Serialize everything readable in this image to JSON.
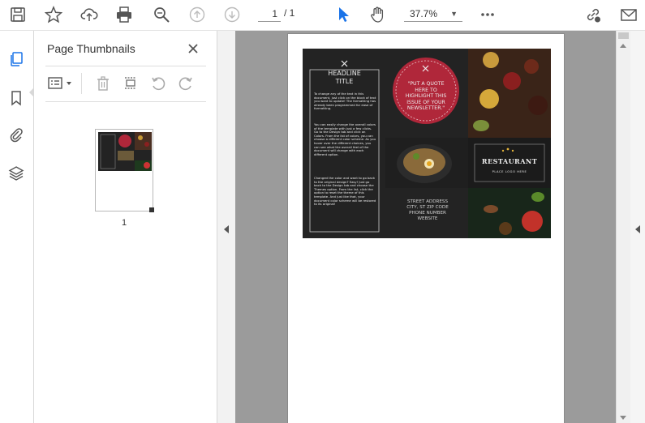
{
  "toolbar": {
    "page_current": "1",
    "page_total": "/ 1",
    "zoom": "37.7%"
  },
  "panel": {
    "title": "Page Thumbnails",
    "thumb_page_number": "1"
  },
  "brochure": {
    "headline": "HEADLINE\nTITLE",
    "body_para_1": "To change any of the text in this document, just click on the block of text you want to update! The formatting has already been programmed for ease of formatting.",
    "body_para_2": "You can easily change the overall colors of the template with just a few clicks. Go to the Design tab and click on Colors. From the list of colors, you can choose a different color scheme. As you hover over the different choices, you can see what the overall feel of the document will change with each different option.",
    "body_para_3": "Changed the color and want to go back to the original design? Easy! Just go back to the Design tab and choose the Themes option. From the list, click the option to reset the theme of this template. And just like that, your document color scheme will be restored to its original!",
    "quote": "\"PUT A QUOTE HERE TO HIGHLIGHT THIS ISSUE OF YOUR NEWSLETTER.\"",
    "restaurant_name": "RESTAURANT",
    "restaurant_tagline": "PLACE LOGO HERE",
    "address_line_1": "STREET ADDRESS",
    "address_line_2": "CITY, ST ZIP CODE",
    "address_line_3": "PHONE NUMBER",
    "address_line_4": "WEBSITE"
  },
  "colors": {
    "accent_red": "#b0273a",
    "pointer_blue": "#1a73e8"
  }
}
